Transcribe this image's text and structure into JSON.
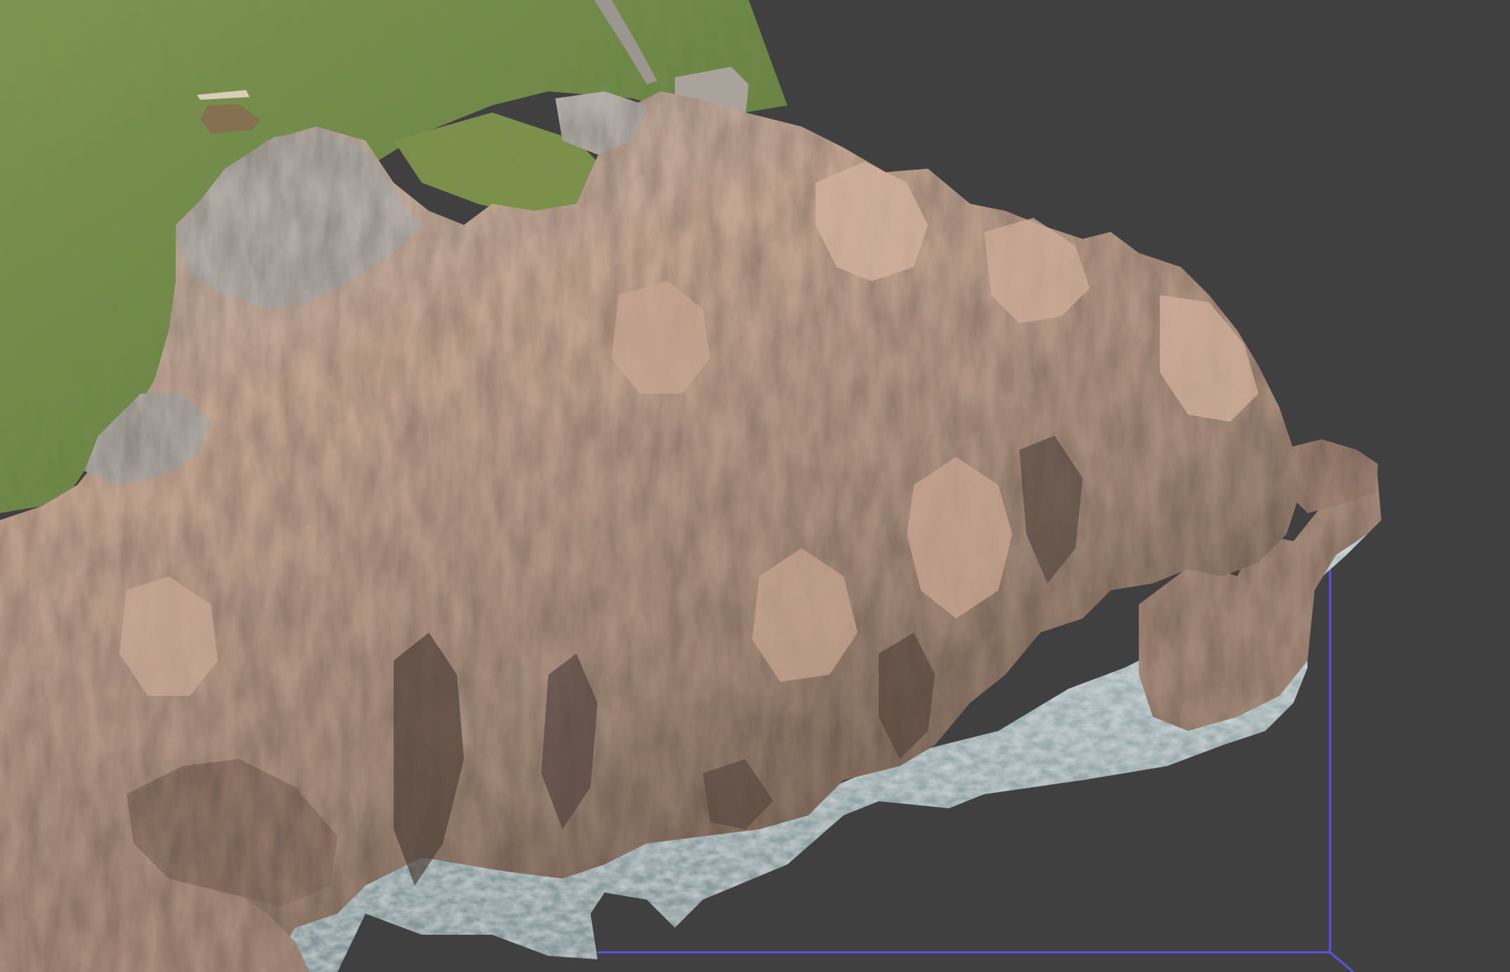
{
  "viewport": {
    "background_color": "#404040",
    "bounding_box_color": "#5a55e6",
    "model": {
      "grass_color": "#6f8a45",
      "rock_light_color": "#c7aa96",
      "rock_gray_color": "#a7a39d",
      "rock_shadow_color": "#5e4c42",
      "water_color": "#9fb2b6"
    }
  }
}
